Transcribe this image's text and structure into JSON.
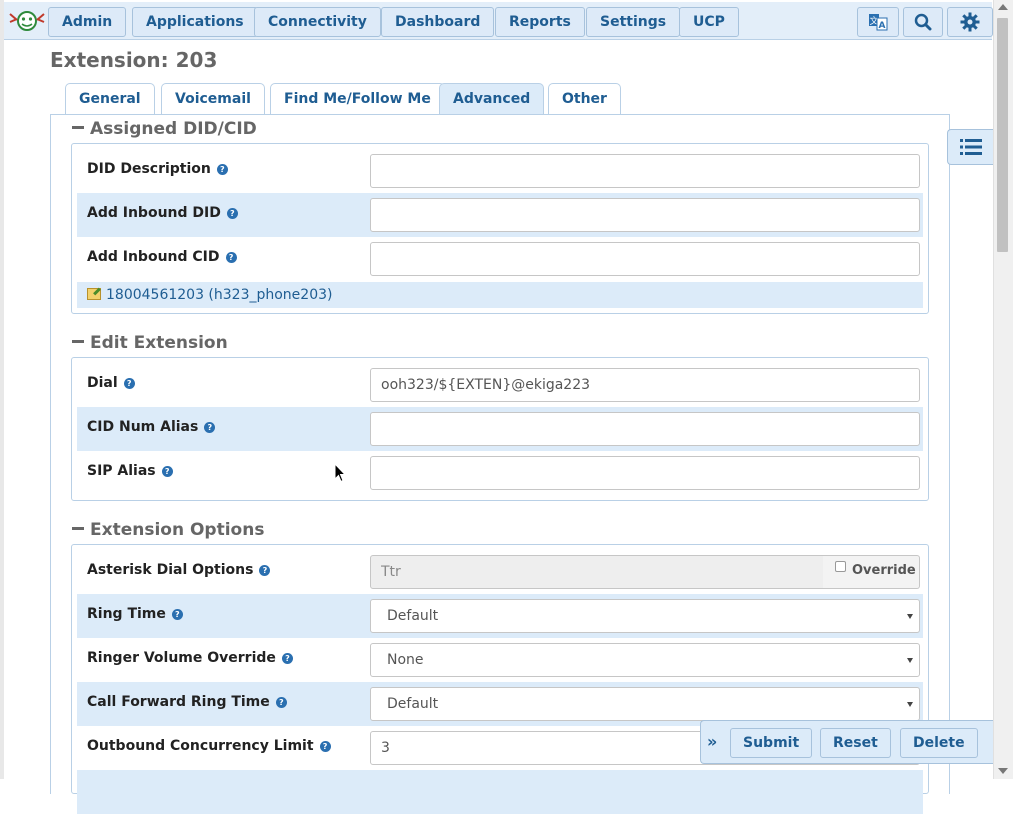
{
  "nav": {
    "items": [
      "Admin",
      "Applications",
      "Connectivity",
      "Dashboard",
      "Reports",
      "Settings",
      "UCP"
    ],
    "icons": [
      "translate-icon",
      "search-icon",
      "gear-icon"
    ]
  },
  "page": {
    "title": "Extension: 203"
  },
  "tabs": [
    {
      "label": "General"
    },
    {
      "label": "Voicemail"
    },
    {
      "label": "Find Me/Follow Me"
    },
    {
      "label": "Advanced",
      "active": true
    },
    {
      "label": "Other"
    }
  ],
  "sections": {
    "did": {
      "title": "Assigned DID/CID",
      "fields": [
        {
          "label": "DID Description",
          "value": ""
        },
        {
          "label": "Add Inbound DID",
          "value": ""
        },
        {
          "label": "Add Inbound CID",
          "value": ""
        }
      ],
      "link": "18004561203 (h323_phone203)"
    },
    "edit": {
      "title": "Edit Extension",
      "fields": [
        {
          "label": "Dial",
          "value": "ooh323/${EXTEN}@ekiga223"
        },
        {
          "label": "CID Num Alias",
          "value": ""
        },
        {
          "label": "SIP Alias",
          "value": ""
        }
      ]
    },
    "options": {
      "title": "Extension Options",
      "fields": [
        {
          "label": "Asterisk Dial Options",
          "value": "Ttr",
          "override_label": "Override"
        },
        {
          "label": "Ring Time",
          "value": "Default"
        },
        {
          "label": "Ringer Volume Override",
          "value": "None"
        },
        {
          "label": "Call Forward Ring Time",
          "value": "Default"
        },
        {
          "label": "Outbound Concurrency Limit",
          "value": "3"
        }
      ]
    }
  },
  "actions": {
    "submit": "Submit",
    "reset": "Reset",
    "delete": "Delete"
  },
  "help_glyph": "?",
  "colors": {
    "accent": "#1f5d92",
    "row_highlight": "#dcebf9",
    "border": "#b9d0e6"
  }
}
